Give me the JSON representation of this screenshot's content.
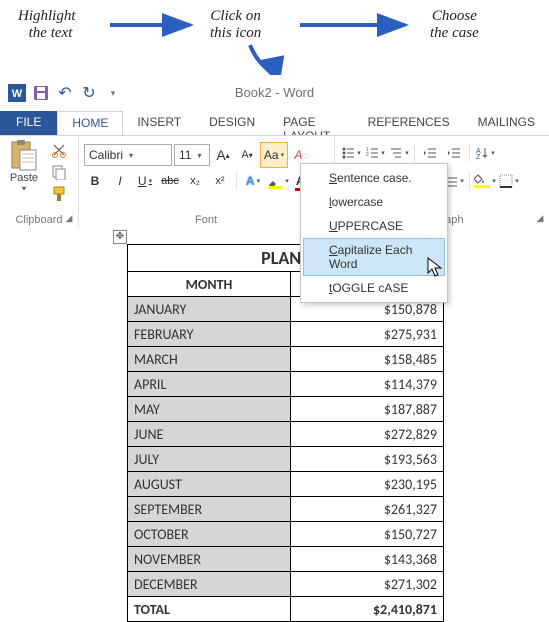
{
  "annot": {
    "a": "Highlight\n  the text",
    "b": "Click on\nthis icon",
    "c": "Choose\nthe case"
  },
  "title": "Book2 - Word",
  "qat": {
    "word": "W",
    "save": "💾",
    "undo": "↶",
    "redo": "↷"
  },
  "tabs": {
    "file": "FILE",
    "home": "HOME",
    "insert": "INSERT",
    "design": "DESIGN",
    "pagelayout": "PAGE LAYOUT",
    "references": "REFERENCES",
    "mailings": "MAILINGS"
  },
  "ribbon": {
    "clipboard": {
      "label": "Clipboard",
      "paste": "Paste"
    },
    "font": {
      "label": "Font",
      "name": "Calibri",
      "size": "11",
      "bold": "B",
      "italic": "I",
      "underline": "U",
      "strike": "abc",
      "sub": "x₂",
      "sup": "x²",
      "grow": "A",
      "shrink": "A",
      "case": "Aa",
      "clear": "A"
    },
    "paragraph": {
      "label": "aragraph"
    }
  },
  "menu": {
    "sentence": "entence case.",
    "lower": "owercase",
    "upper": "PPERCASE",
    "capitalize": "apitalize Each Word",
    "toggle": "OGGLE cASE"
  },
  "table": {
    "title": "PLANE",
    "col1": "MONTH",
    "rows": [
      {
        "m": "JANUARY",
        "v": "$150,878"
      },
      {
        "m": "FEBRUARY",
        "v": "$275,931"
      },
      {
        "m": "MARCH",
        "v": "$158,485"
      },
      {
        "m": "APRIL",
        "v": "$114,379"
      },
      {
        "m": "MAY",
        "v": "$187,887"
      },
      {
        "m": "JUNE",
        "v": "$272,829"
      },
      {
        "m": "JULY",
        "v": "$193,563"
      },
      {
        "m": "AUGUST",
        "v": "$230,195"
      },
      {
        "m": "SEPTEMBER",
        "v": "$261,327"
      },
      {
        "m": "OCTOBER",
        "v": "$150,727"
      },
      {
        "m": "NOVEMBER",
        "v": "$143,368"
      },
      {
        "m": "DECEMBER",
        "v": "$271,302"
      }
    ],
    "total_label": "TOTAL",
    "total_value": "$2,410,871"
  }
}
